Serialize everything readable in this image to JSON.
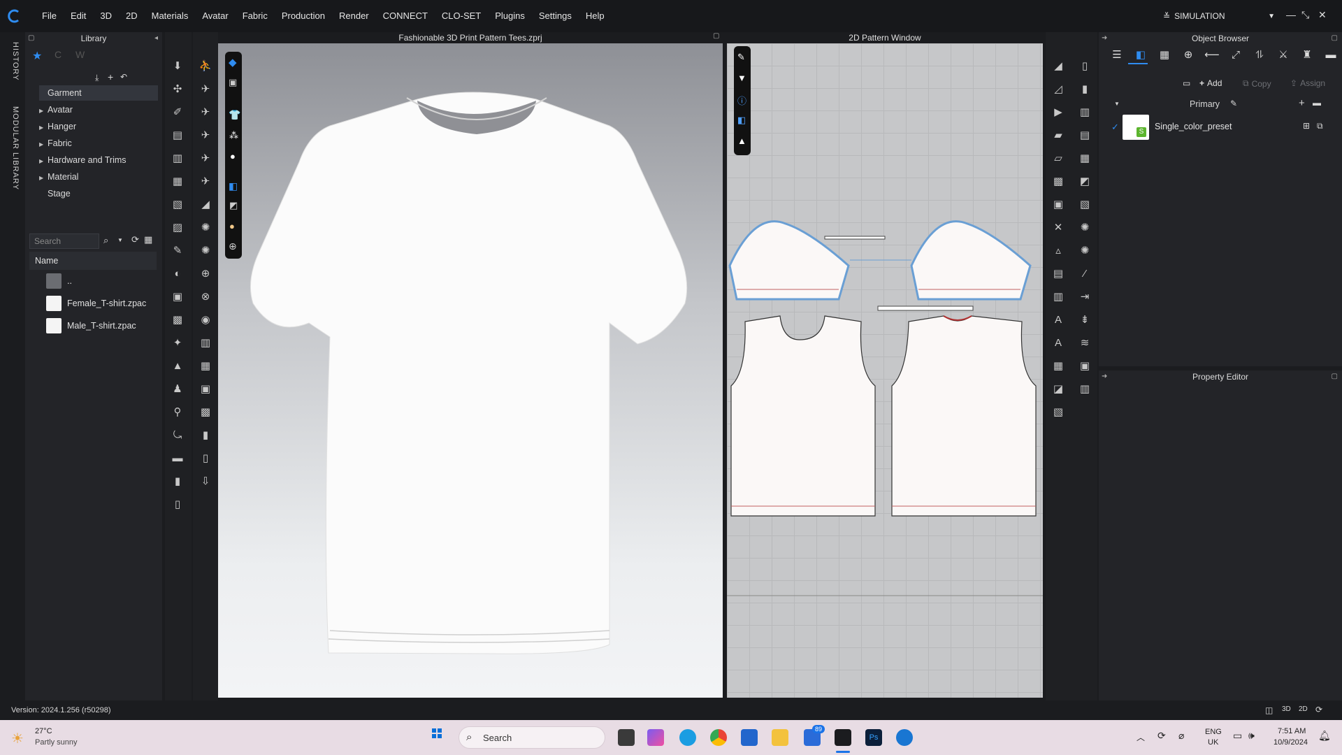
{
  "menu": [
    "File",
    "Edit",
    "3D",
    "2D",
    "Materials",
    "Avatar",
    "Fabric",
    "Production",
    "Render",
    "CONNECT",
    "CLO-SET",
    "Plugins",
    "Settings",
    "Help"
  ],
  "mode": {
    "label": "SIMULATION"
  },
  "vtabs": {
    "history": "HISTORY",
    "modular": "MODULAR LIBRARY"
  },
  "library": {
    "title": "Library",
    "tree": [
      "Garment",
      "Avatar",
      "Hanger",
      "Fabric",
      "Hardware and Trims",
      "Material",
      "Stage"
    ],
    "search_placeholder": "Search",
    "name_header": "Name",
    "files": [
      "..",
      "Female_T-shirt.zpac",
      "Male_T-shirt.zpac"
    ]
  },
  "win3d": {
    "title": "Fashionable 3D Print Pattern Tees.zprj"
  },
  "win2d": {
    "title": "2D Pattern Window"
  },
  "object_browser": {
    "title": "Object Browser",
    "add": "Add",
    "copy": "Copy",
    "assign": "Assign",
    "group": "Primary",
    "item": "Single_color_preset"
  },
  "property_editor": {
    "title": "Property Editor"
  },
  "status": {
    "version": "Version: 2024.1.256 (r50298)"
  },
  "taskbar": {
    "temp": "27°C",
    "weather": "Partly sunny",
    "search": "Search",
    "badge": "89",
    "lang1": "ENG",
    "lang2": "UK",
    "time": "7:51 AM",
    "date": "10/9/2024"
  },
  "colors": {
    "accent": "#2f8cf0",
    "garment": "#fafafa",
    "seam_blue": "#6a9fd4"
  }
}
